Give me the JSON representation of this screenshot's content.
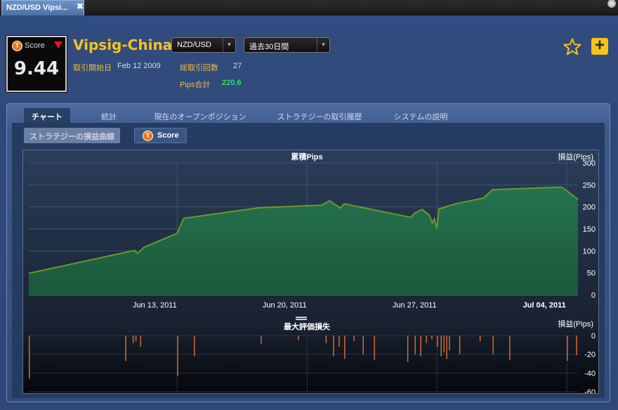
{
  "window": {
    "tab_title": "NZD/USD Vipsi...",
    "close_glyph": "✖"
  },
  "header": {
    "score_label": "Score",
    "score_badge": "T",
    "score_value": "9.44",
    "strategy_name": "Vipsig-China",
    "pair_select": "NZD/USD",
    "period_select": "過去30日間",
    "start_label": "取引開始日",
    "start_value": "Feb 12 2009",
    "trades_label": "総取引回数",
    "trades_value": "27",
    "pips_label": "Pips合計",
    "pips_value": "220.6",
    "plus_glyph": "+"
  },
  "tabs": [
    "チャート",
    "統計",
    "現在のオープンポジション",
    "ストラテジーの取引履歴",
    "システムの説明"
  ],
  "subbuttons": {
    "curve": "ストラテジーの損益曲線",
    "score": "Score",
    "score_badge": "T"
  },
  "colors": {
    "accent": "#f7c21f",
    "positive": "#34e05a",
    "area_fill": "#1e6a46",
    "area_line": "#6a9a28",
    "drawdown": "#e07030",
    "score_down": "#e8101c"
  },
  "chart_data": [
    {
      "type": "area",
      "title": "累積Pips",
      "ylabel": "損益(Pips)",
      "ylim": [
        0,
        300
      ],
      "yticks": [
        0,
        50,
        100,
        150,
        200,
        250,
        300
      ],
      "xtick_labels": [
        "Jun 13, 2011",
        "Jun 20, 2011",
        "Jun 27, 2011",
        "Jul 04, 2011"
      ],
      "xtick_days": [
        13,
        20,
        27,
        34
      ],
      "xlim_days": [
        5.0,
        33.0
      ],
      "x_unit": "day of June 2011",
      "grid": true,
      "points": [
        [
          5.0,
          49
        ],
        [
          10.7,
          101
        ],
        [
          10.85,
          94
        ],
        [
          11.2,
          108
        ],
        [
          13.0,
          140
        ],
        [
          13.35,
          174
        ],
        [
          17.4,
          198
        ],
        [
          20.8,
          204
        ],
        [
          21.2,
          214
        ],
        [
          21.8,
          197
        ],
        [
          22.0,
          207
        ],
        [
          25.6,
          176
        ],
        [
          25.8,
          186
        ],
        [
          26.2,
          194
        ],
        [
          26.6,
          181
        ],
        [
          26.75,
          163
        ],
        [
          26.85,
          173
        ],
        [
          27.0,
          151
        ],
        [
          27.1,
          195
        ],
        [
          28.0,
          207
        ],
        [
          29.5,
          220
        ],
        [
          30.0,
          239
        ],
        [
          33.7,
          245
        ],
        [
          33.8,
          243
        ],
        [
          34.6,
          217
        ]
      ]
    },
    {
      "type": "bar",
      "title": "最大評価損失",
      "ylabel": "損益(Pips)",
      "ylim": [
        -60,
        0
      ],
      "yticks": [
        0,
        -20,
        -40,
        -60
      ],
      "x_unit": "day of June 2011",
      "bars": [
        [
          5.0,
          -46
        ],
        [
          10.2,
          -27
        ],
        [
          10.6,
          -8
        ],
        [
          10.75,
          -6
        ],
        [
          11.0,
          -12
        ],
        [
          13.0,
          -43
        ],
        [
          13.9,
          -22
        ],
        [
          17.5,
          -9
        ],
        [
          19.5,
          -5
        ],
        [
          21.0,
          -8
        ],
        [
          21.4,
          -22
        ],
        [
          21.7,
          -12
        ],
        [
          22.0,
          -25
        ],
        [
          22.5,
          -6
        ],
        [
          23.0,
          -20
        ],
        [
          23.6,
          -26
        ],
        [
          25.4,
          -28
        ],
        [
          25.8,
          -20
        ],
        [
          26.1,
          -22
        ],
        [
          26.4,
          -8
        ],
        [
          26.7,
          -4
        ],
        [
          27.0,
          -12
        ],
        [
          27.2,
          -22
        ],
        [
          27.35,
          -18
        ],
        [
          27.5,
          -25
        ],
        [
          27.65,
          -16
        ],
        [
          28.2,
          -20
        ],
        [
          29.3,
          -6
        ],
        [
          30.0,
          -20
        ],
        [
          30.9,
          -26
        ],
        [
          34.0,
          -27
        ],
        [
          34.5,
          -21
        ]
      ]
    }
  ]
}
